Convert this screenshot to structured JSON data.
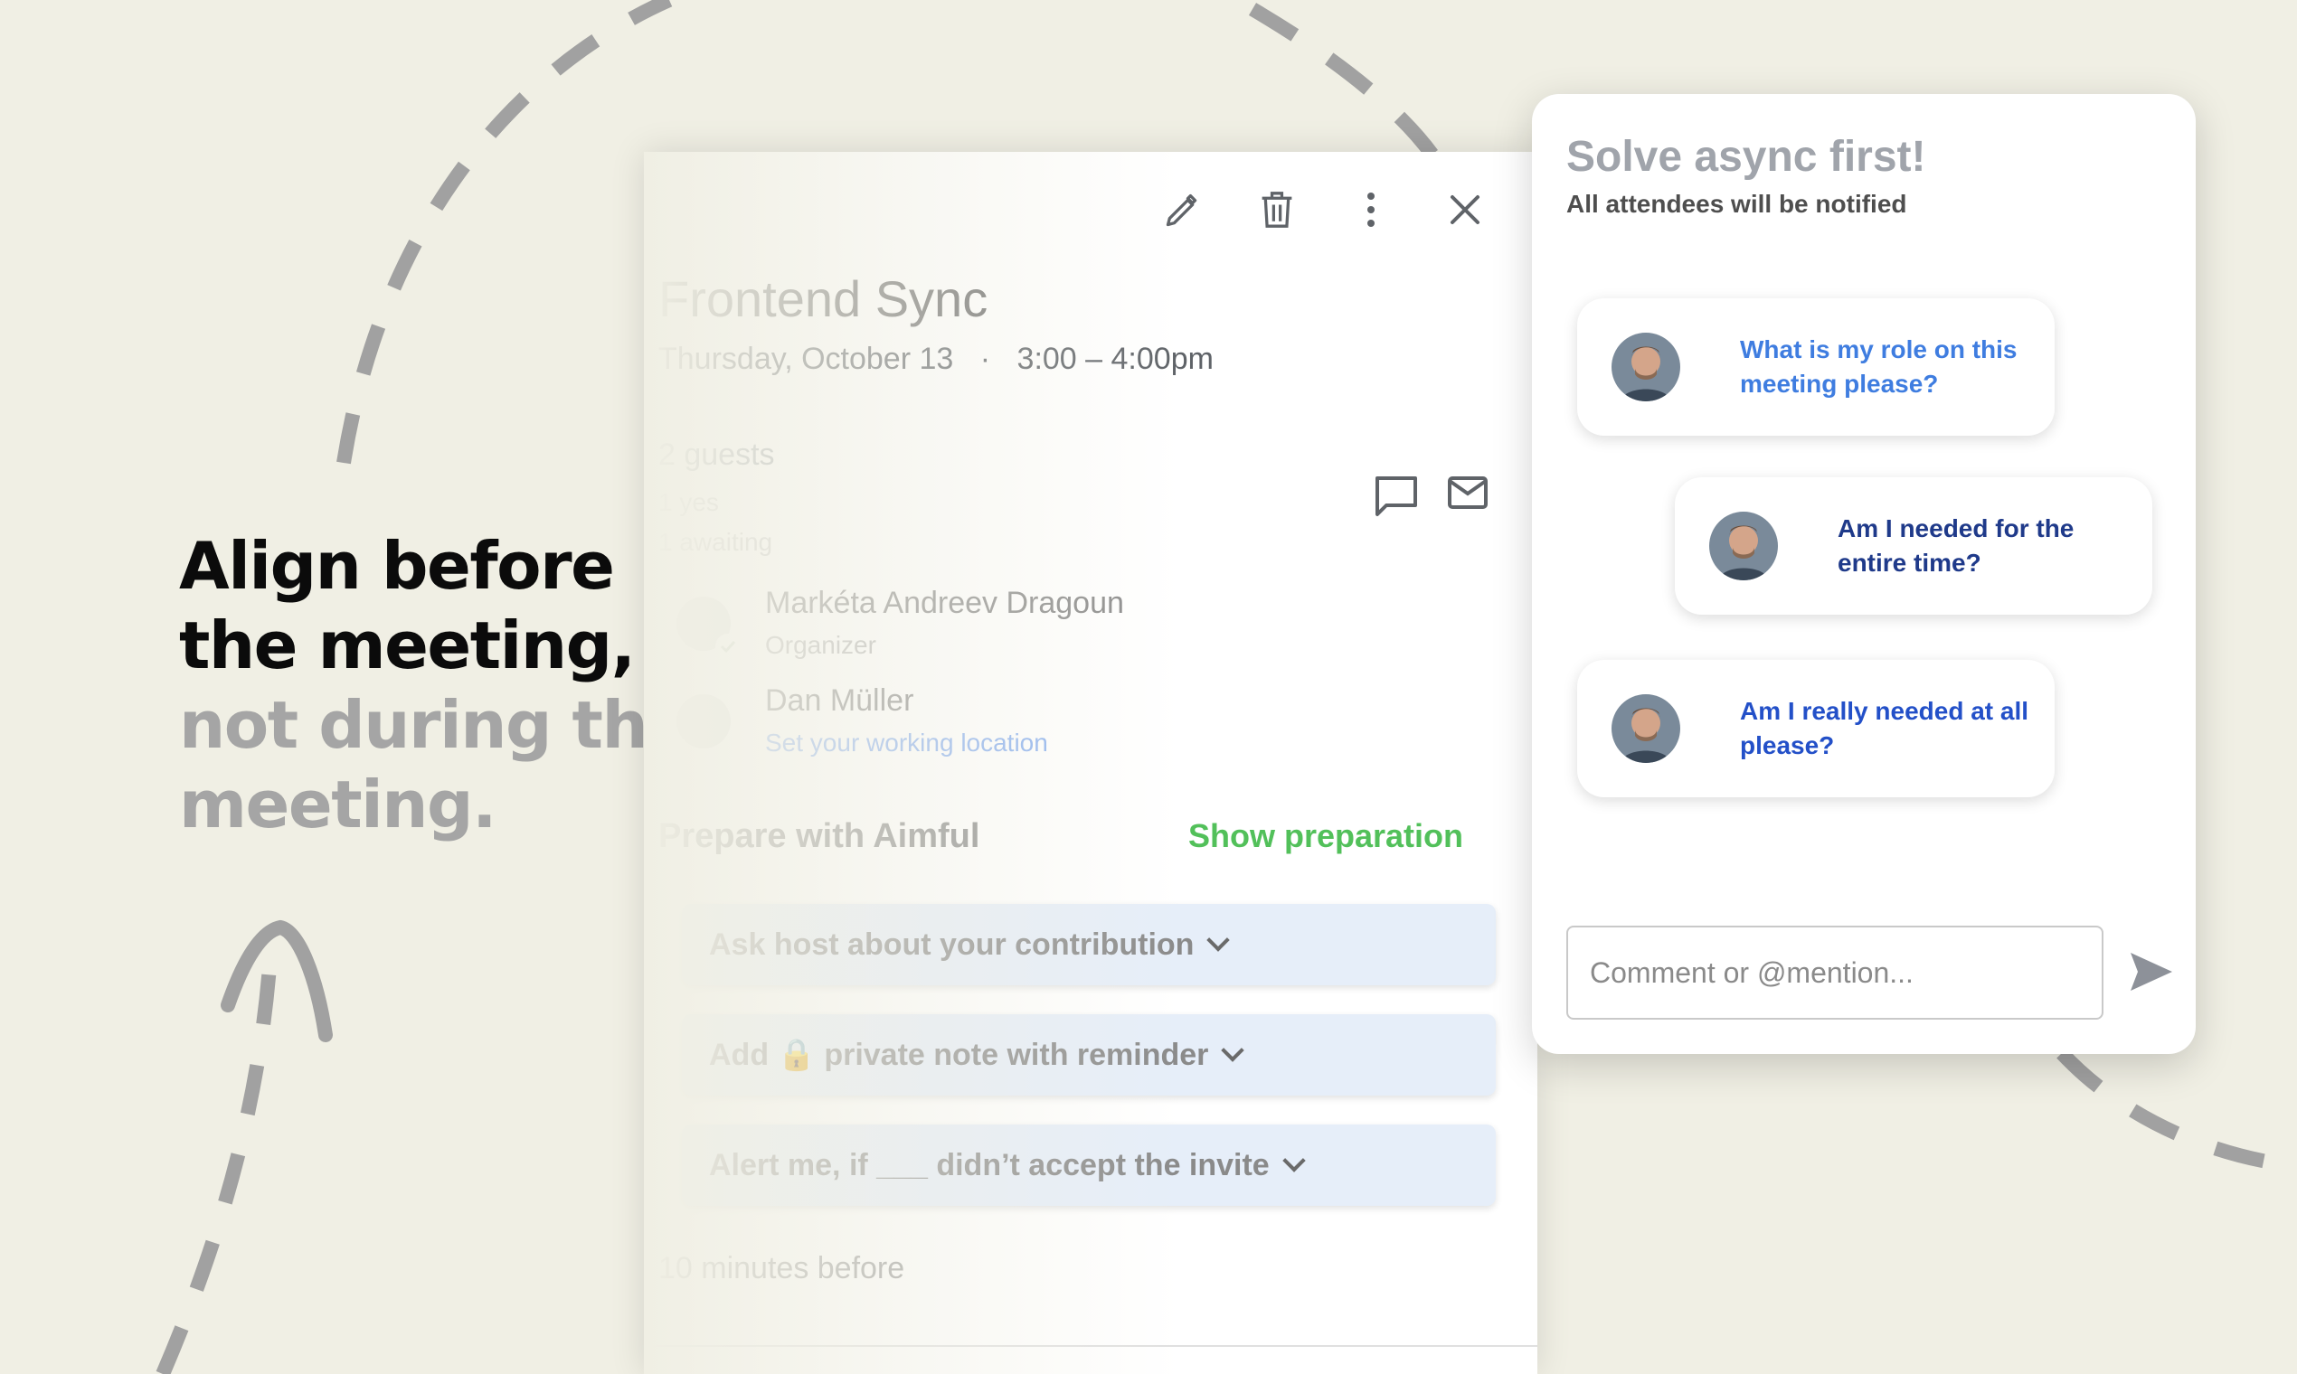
{
  "headline": {
    "line1": "Align before",
    "line2": "the meeting,",
    "line3": "not during the",
    "line4": "meeting."
  },
  "toolbar": {
    "edit": "pencil-icon",
    "delete": "trash-icon",
    "more": "more-vert-icon",
    "close": "close-icon"
  },
  "event": {
    "title": "Frontend Sync",
    "date": "Thursday, October 13",
    "separator": "·",
    "time": "3:00 – 4:00pm",
    "guests_title": "2 guests",
    "guests_yes": "1 yes",
    "guests_awaiting": "1 awaiting",
    "guests": [
      {
        "name": "Markéta Andreev Dragoun",
        "sub": "Organizer"
      },
      {
        "name": "Dan Müller",
        "sub": "Set your working location"
      }
    ],
    "prep_title": "Prepare with Aimful",
    "prep_link": "Show preparation",
    "prep_items": [
      "Ask host about your contribution",
      "Add 🔒 private note with reminder",
      "Alert me, if ___ didn’t accept the invite"
    ],
    "reminder": "10 minutes before"
  },
  "panel": {
    "title": "Solve async first!",
    "subtitle": "All attendees will be notified",
    "comments": [
      {
        "text": "What is my role on this meeting please?",
        "color": "#3f7de0"
      },
      {
        "text": "Am I needed for the entire time?",
        "color": "#1f3a8a"
      },
      {
        "text": "Am I really needed at all please?",
        "color": "#2350c8"
      }
    ],
    "input_placeholder": "Comment or @mention..."
  },
  "colors": {
    "background": "#f0efe4",
    "accent_green": "#52c05a",
    "link_blue": "#3f7de0"
  }
}
